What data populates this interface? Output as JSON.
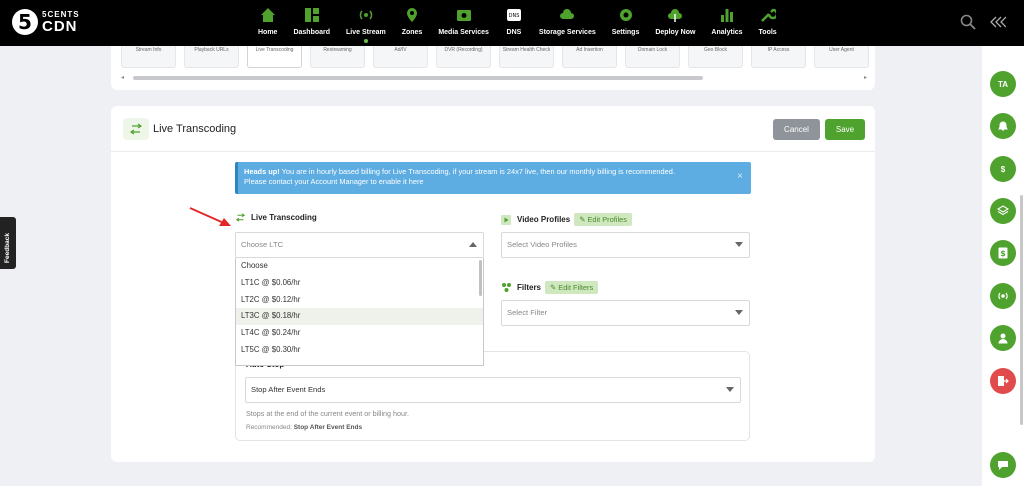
{
  "brand": {
    "top": "5CENTS",
    "bottom": "CDN",
    "number": "5"
  },
  "nav": [
    {
      "label": "Home",
      "icon": "home-icon"
    },
    {
      "label": "Dashboard",
      "icon": "dashboard-icon"
    },
    {
      "label": "Live Stream",
      "icon": "broadcast-icon",
      "active": true
    },
    {
      "label": "Zones",
      "icon": "map-pin-icon"
    },
    {
      "label": "Media Services",
      "icon": "media-icon"
    },
    {
      "label": "DNS",
      "icon": "dns-icon"
    },
    {
      "label": "Storage Services",
      "icon": "cloud-icon"
    },
    {
      "label": "Settings",
      "icon": "gear-icon"
    },
    {
      "label": "Deploy Now",
      "icon": "deploy-icon"
    },
    {
      "label": "Analytics",
      "icon": "bar-chart-icon"
    },
    {
      "label": "Tools",
      "icon": "wrench-icon"
    }
  ],
  "strip": [
    "Stream Info",
    "Playback URLs",
    "Live Transcoding",
    "Restreaming",
    "Ad/IV",
    "DVR (Recording)",
    "Stream Health Check",
    "Ad Insertion",
    "Domain Lock",
    "Geo Block",
    "IP Access",
    "User Agent"
  ],
  "card": {
    "title": "Live Transcoding",
    "cancel": "Cancel",
    "save": "Save"
  },
  "alert": {
    "bold": "Heads up!",
    "line1": " You are in hourly based billing for Live Transcoding, if your stream is 24x7 live, then our monthly billing is recommended.",
    "line2": "Please contact your Account Manager to enable it here",
    "close": "×"
  },
  "transcoding": {
    "label": "Live Transcoding",
    "placeholder": "Choose LTC",
    "options": [
      "Choose",
      "LT1C @ $0.06/hr",
      "LT2C @ $0.12/hr",
      "LT3C @ $0.18/hr",
      "LT4C @ $0.24/hr",
      "LT5C @ $0.30/hr"
    ],
    "highlighted": 3
  },
  "profiles": {
    "label": "Video Profiles",
    "edit": "Edit Profiles",
    "placeholder": "Select Video Profiles"
  },
  "filters": {
    "label": "Filters",
    "edit": "Edit Filters",
    "placeholder": "Select Filter"
  },
  "autostop": {
    "label": "Auto Stop",
    "value": "Stop After Event Ends",
    "help": "Stops at the end of the current event or billing hour.",
    "rec_label": "Recommended:",
    "rec_value": "Stop After Event Ends"
  },
  "user": {
    "initials": "TA"
  },
  "feedback": "Feedback",
  "colors": {
    "accent": "#4fa22e",
    "alert": "#5dade2",
    "nav_bg": "#000000"
  }
}
